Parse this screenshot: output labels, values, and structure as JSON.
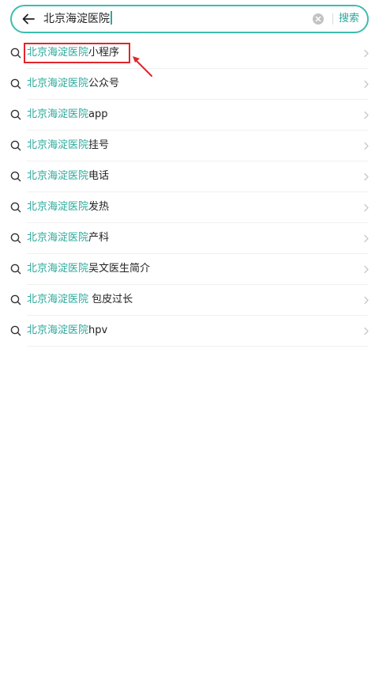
{
  "search": {
    "query": "北京海淀医院",
    "submit_label": "搜索",
    "icons": {
      "back": "arrow-left-icon",
      "clear": "clear-circle-icon"
    }
  },
  "suggestions": [
    {
      "highlight": "北京海淀医院",
      "rest": "小程序"
    },
    {
      "highlight": "北京海淀医院",
      "rest": "公众号"
    },
    {
      "highlight": "北京海淀医院",
      "rest": "app"
    },
    {
      "highlight": "北京海淀医院",
      "rest": "挂号"
    },
    {
      "highlight": "北京海淀医院",
      "rest": "电话"
    },
    {
      "highlight": "北京海淀医院",
      "rest": "发热"
    },
    {
      "highlight": "北京海淀医院",
      "rest": "产科"
    },
    {
      "highlight": "北京海淀医院",
      "rest": "吴文医生简介"
    },
    {
      "highlight": "北京海淀医院",
      "rest": " 包皮过长"
    },
    {
      "highlight": "北京海淀医院",
      "rest": "hpv"
    }
  ],
  "colors": {
    "accent": "#2aa99b",
    "search_border": "#3dbdae",
    "annotation": "#e0262b",
    "text": "#222222"
  },
  "annotation": {
    "target": "suggestion-0",
    "icon": "red-arrow-icon"
  }
}
